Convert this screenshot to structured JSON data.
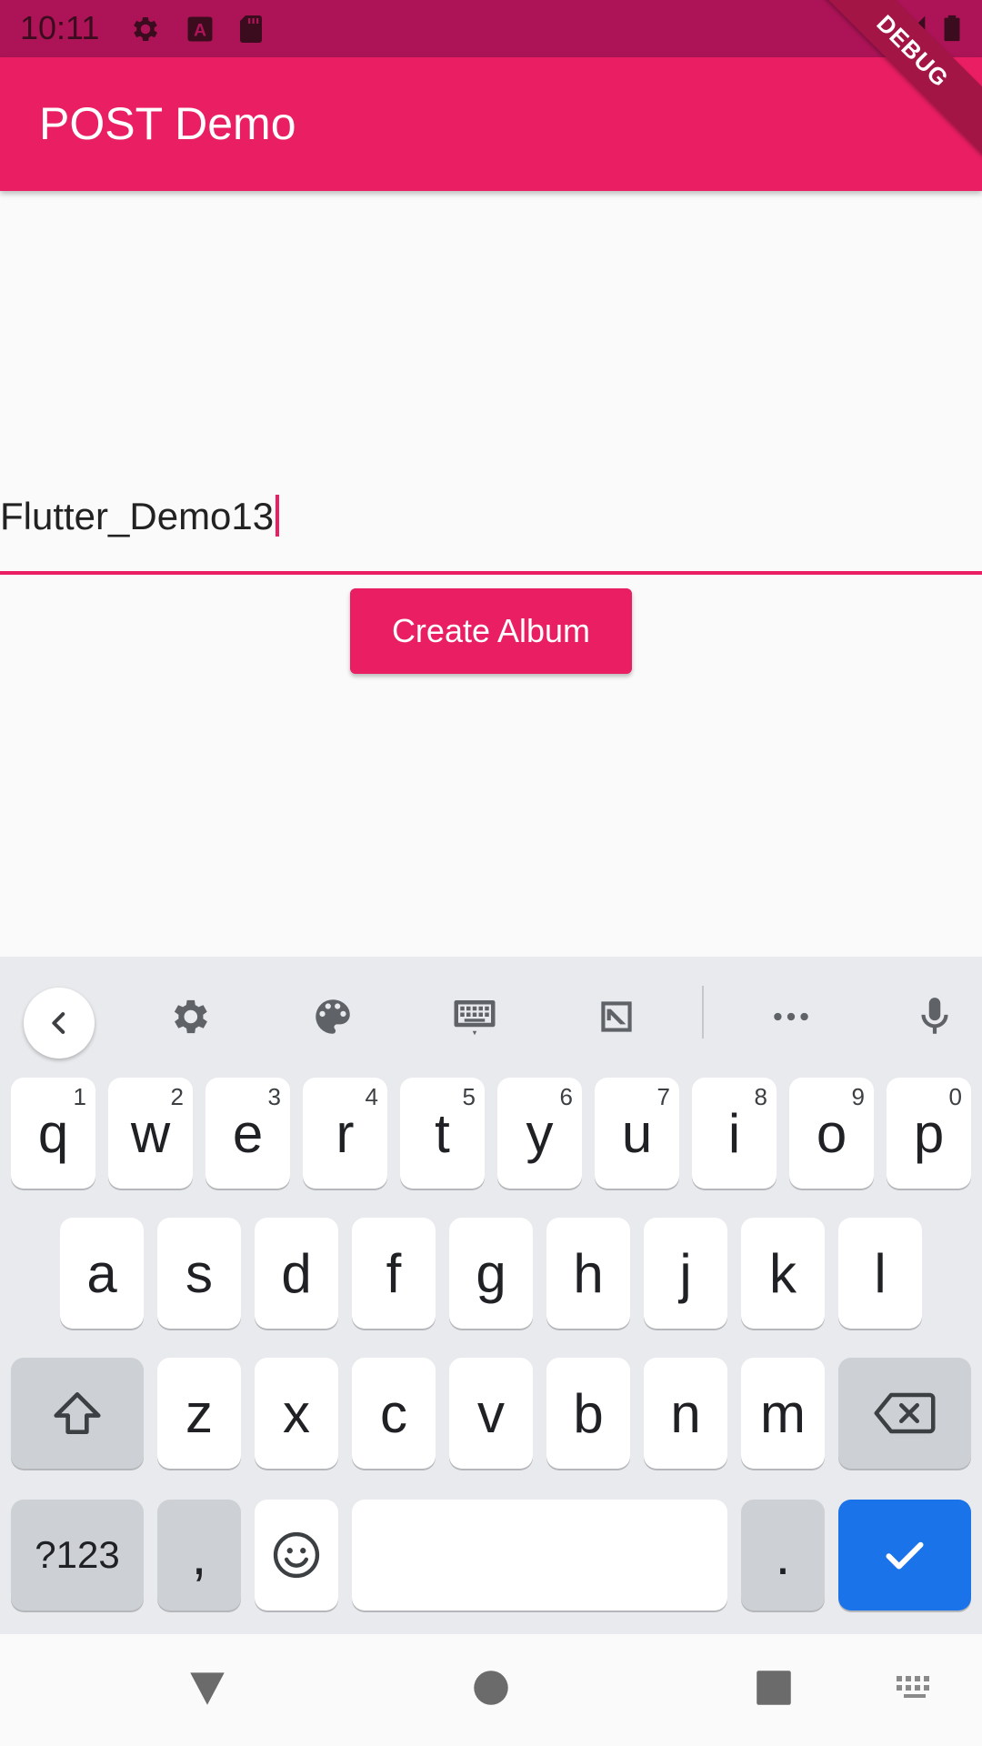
{
  "status_bar": {
    "time": "10:11",
    "icons": [
      "gear-icon",
      "a-icon",
      "sd-card-icon",
      "wifi-icon",
      "signal-icon",
      "battery-icon"
    ]
  },
  "app_bar": {
    "title": "POST Demo"
  },
  "debug_banner": {
    "label": "DEBUG"
  },
  "form": {
    "text_value": "Flutter_Demo13",
    "button_label": "Create Album"
  },
  "keyboard": {
    "toolbar_icons": [
      "back-chevron-icon",
      "settings-gear-icon",
      "palette-icon",
      "keyboard-icon",
      "selection-icon",
      "more-dots-icon",
      "microphone-icon"
    ],
    "row1": [
      {
        "key": "q",
        "hint": "1"
      },
      {
        "key": "w",
        "hint": "2"
      },
      {
        "key": "e",
        "hint": "3"
      },
      {
        "key": "r",
        "hint": "4"
      },
      {
        "key": "t",
        "hint": "5"
      },
      {
        "key": "y",
        "hint": "6"
      },
      {
        "key": "u",
        "hint": "7"
      },
      {
        "key": "i",
        "hint": "8"
      },
      {
        "key": "o",
        "hint": "9"
      },
      {
        "key": "p",
        "hint": "0"
      }
    ],
    "row2": [
      "a",
      "s",
      "d",
      "f",
      "g",
      "h",
      "j",
      "k",
      "l"
    ],
    "row3": [
      "z",
      "x",
      "c",
      "v",
      "b",
      "n",
      "m"
    ],
    "symbols_label": "?123",
    "comma": ",",
    "period": "."
  },
  "colors": {
    "primary": "#e91e63",
    "status_bar": "#ad1457",
    "action_key": "#1a73e8"
  }
}
